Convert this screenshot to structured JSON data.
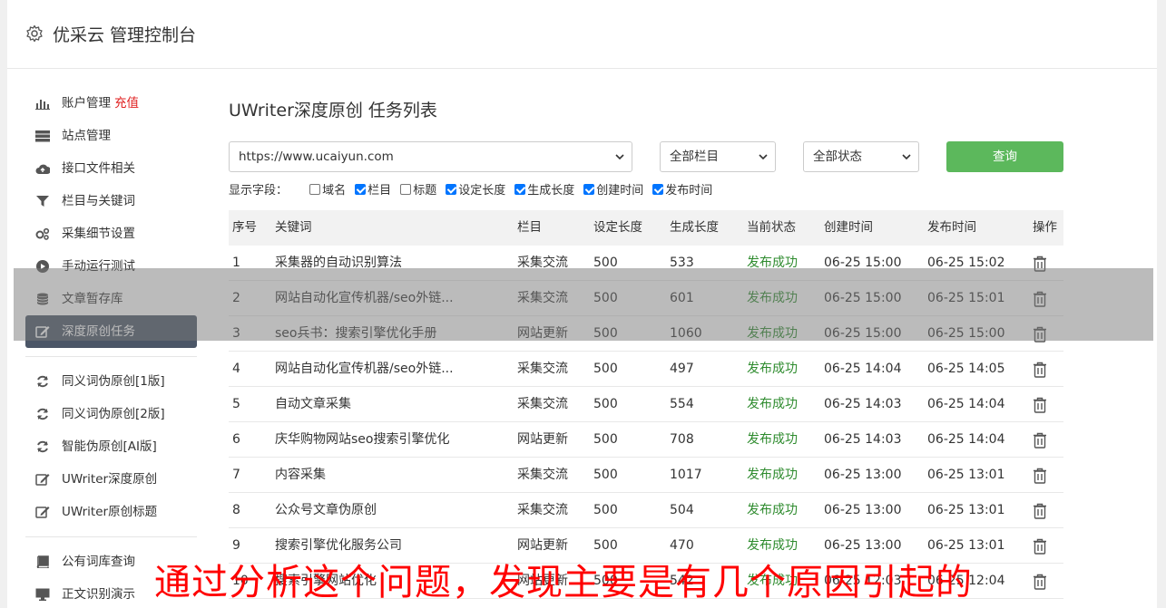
{
  "header": {
    "title": "优采云 管理控制台"
  },
  "sidebar": {
    "group1": [
      {
        "label": "账户管理",
        "tag": "充值",
        "icon": "bar-chart-icon"
      },
      {
        "label": "站点管理",
        "icon": "server-icon"
      },
      {
        "label": "接口文件相关",
        "icon": "cloud-upload-icon"
      },
      {
        "label": "栏目与关键词",
        "icon": "filter-icon"
      },
      {
        "label": "采集细节设置",
        "icon": "gears-icon"
      },
      {
        "label": "手动运行测试",
        "icon": "play-icon"
      },
      {
        "label": "文章暂存库",
        "icon": "database-icon"
      },
      {
        "label": "深度原创任务",
        "icon": "edit-icon",
        "active": true
      }
    ],
    "group2": [
      {
        "label": "同义词伪原创[1版]",
        "icon": "refresh-icon"
      },
      {
        "label": "同义词伪原创[2版]",
        "icon": "refresh-icon"
      },
      {
        "label": "智能伪原创[AI版]",
        "icon": "refresh-icon"
      },
      {
        "label": "UWriter深度原创",
        "icon": "edit-icon"
      },
      {
        "label": "UWriter原创标题",
        "icon": "edit-icon"
      }
    ],
    "group3": [
      {
        "label": "公有词库查询",
        "icon": "book-icon"
      },
      {
        "label": "正文识别演示",
        "icon": "monitor-icon"
      }
    ]
  },
  "main": {
    "title": "UWriter深度原创 任务列表",
    "filters": {
      "site": "https://www.ucaiyun.com",
      "column": "全部栏目",
      "status": "全部状态",
      "query_label": "查询"
    },
    "fields_label": "显示字段：",
    "fields": [
      {
        "label": "域名",
        "checked": false
      },
      {
        "label": "栏目",
        "checked": true
      },
      {
        "label": "标题",
        "checked": false
      },
      {
        "label": "设定长度",
        "checked": true
      },
      {
        "label": "生成长度",
        "checked": true
      },
      {
        "label": "创建时间",
        "checked": true
      },
      {
        "label": "发布时间",
        "checked": true
      }
    ],
    "table": {
      "headers": [
        "序号",
        "关键词",
        "栏目",
        "设定长度",
        "生成长度",
        "当前状态",
        "创建时间",
        "发布时间",
        "操作"
      ],
      "rows": [
        {
          "idx": "1",
          "kw": "采集器的自动识别算法",
          "col": "采集交流",
          "set": "500",
          "gen": "533",
          "st": "发布成功",
          "ct": "06-25 15:00",
          "pt": "06-25 15:02"
        },
        {
          "idx": "2",
          "kw": "网站自动化宣传机器/seo外链...",
          "col": "采集交流",
          "set": "500",
          "gen": "601",
          "st": "发布成功",
          "ct": "06-25 15:00",
          "pt": "06-25 15:01"
        },
        {
          "idx": "3",
          "kw": "seo兵书：搜索引擎优化手册",
          "col": "网站更新",
          "set": "500",
          "gen": "1060",
          "st": "发布成功",
          "ct": "06-25 15:00",
          "pt": "06-25 15:00"
        },
        {
          "idx": "4",
          "kw": "网站自动化宣传机器/seo外链...",
          "col": "采集交流",
          "set": "500",
          "gen": "497",
          "st": "发布成功",
          "ct": "06-25 14:04",
          "pt": "06-25 14:05"
        },
        {
          "idx": "5",
          "kw": "自动文章采集",
          "col": "采集交流",
          "set": "500",
          "gen": "554",
          "st": "发布成功",
          "ct": "06-25 14:03",
          "pt": "06-25 14:04"
        },
        {
          "idx": "6",
          "kw": "庆华购物网站seo搜索引擎优化",
          "col": "网站更新",
          "set": "500",
          "gen": "708",
          "st": "发布成功",
          "ct": "06-25 14:03",
          "pt": "06-25 14:04"
        },
        {
          "idx": "7",
          "kw": "内容采集",
          "col": "采集交流",
          "set": "500",
          "gen": "1017",
          "st": "发布成功",
          "ct": "06-25 13:00",
          "pt": "06-25 13:01"
        },
        {
          "idx": "8",
          "kw": "公众号文章伪原创",
          "col": "采集交流",
          "set": "500",
          "gen": "504",
          "st": "发布成功",
          "ct": "06-25 13:00",
          "pt": "06-25 13:01"
        },
        {
          "idx": "9",
          "kw": "搜索引擎优化服务公司",
          "col": "网站更新",
          "set": "500",
          "gen": "470",
          "st": "发布成功",
          "ct": "06-25 13:00",
          "pt": "06-25 13:01"
        },
        {
          "idx": "10",
          "kw": "搜索引擎网站优化",
          "col": "网站更新",
          "set": "500",
          "gen": "542",
          "st": "发布成功",
          "ct": "06-25 12:03",
          "pt": "06-25 12:04"
        }
      ]
    }
  },
  "caption": "通过分析这个问题，发现主要是有几个原因引起的",
  "colors": {
    "accent_green": "#5cb85c",
    "active_nav": "#4b5667",
    "status_ok": "#2e8b2e",
    "tag_red": "#e02020",
    "caption_red": "#ff0000"
  }
}
